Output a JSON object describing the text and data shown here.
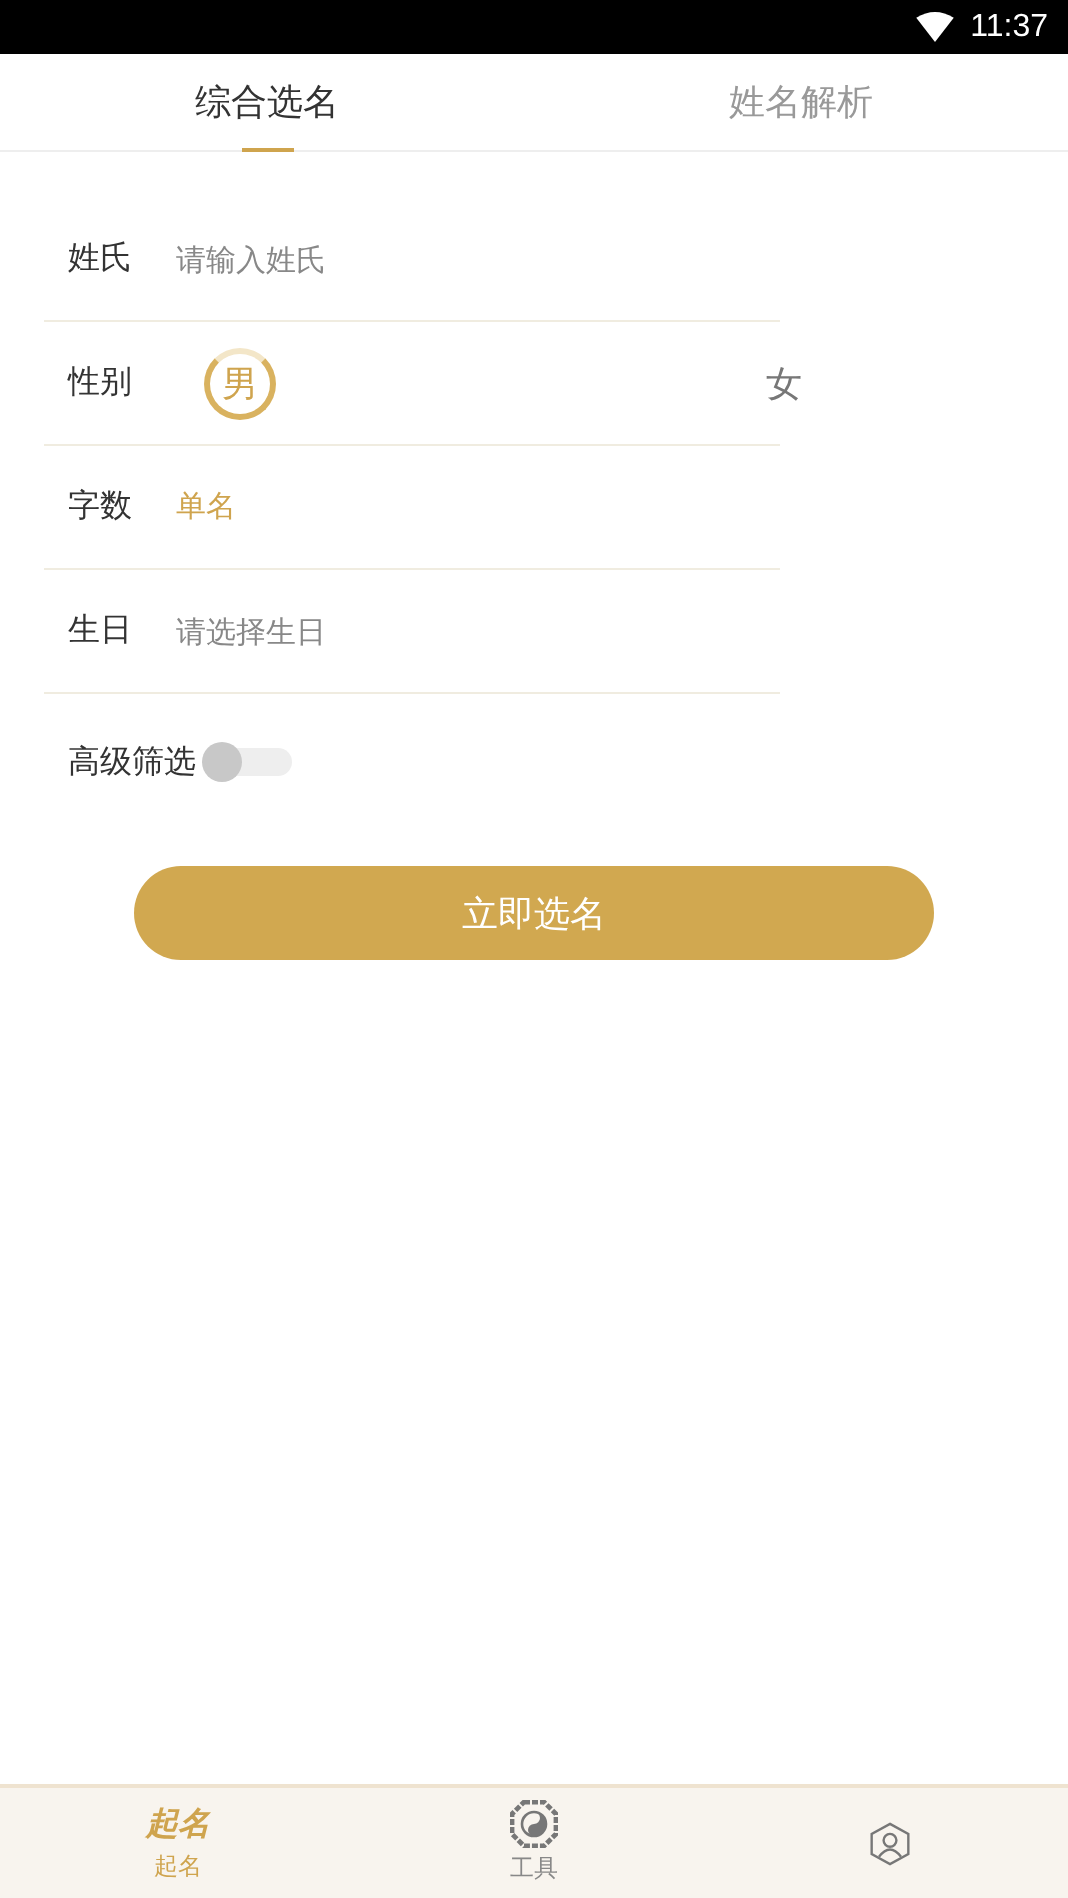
{
  "status_bar": {
    "time": "11:37"
  },
  "tabs": [
    {
      "label": "综合选名",
      "selected": true
    },
    {
      "label": "姓名解析",
      "selected": false
    }
  ],
  "form": {
    "surname": {
      "label": "姓氏",
      "placeholder": "请输入姓氏"
    },
    "gender": {
      "label": "性别",
      "options": [
        {
          "label": "男",
          "selected": true
        },
        {
          "label": "女",
          "selected": false
        }
      ]
    },
    "char_count": {
      "label": "字数",
      "value": "单名"
    },
    "birthday": {
      "label": "生日",
      "placeholder": "请选择生日"
    },
    "advanced_filter": {
      "label": "高级筛选",
      "on": false
    }
  },
  "submit_button": "立即选名",
  "bottom_nav": [
    {
      "kind": "calligraphy",
      "glyph": "起名",
      "label": "起名",
      "selected": true
    },
    {
      "kind": "bagua",
      "label": "工具",
      "selected": false
    },
    {
      "kind": "profile",
      "selected": false
    }
  ]
}
